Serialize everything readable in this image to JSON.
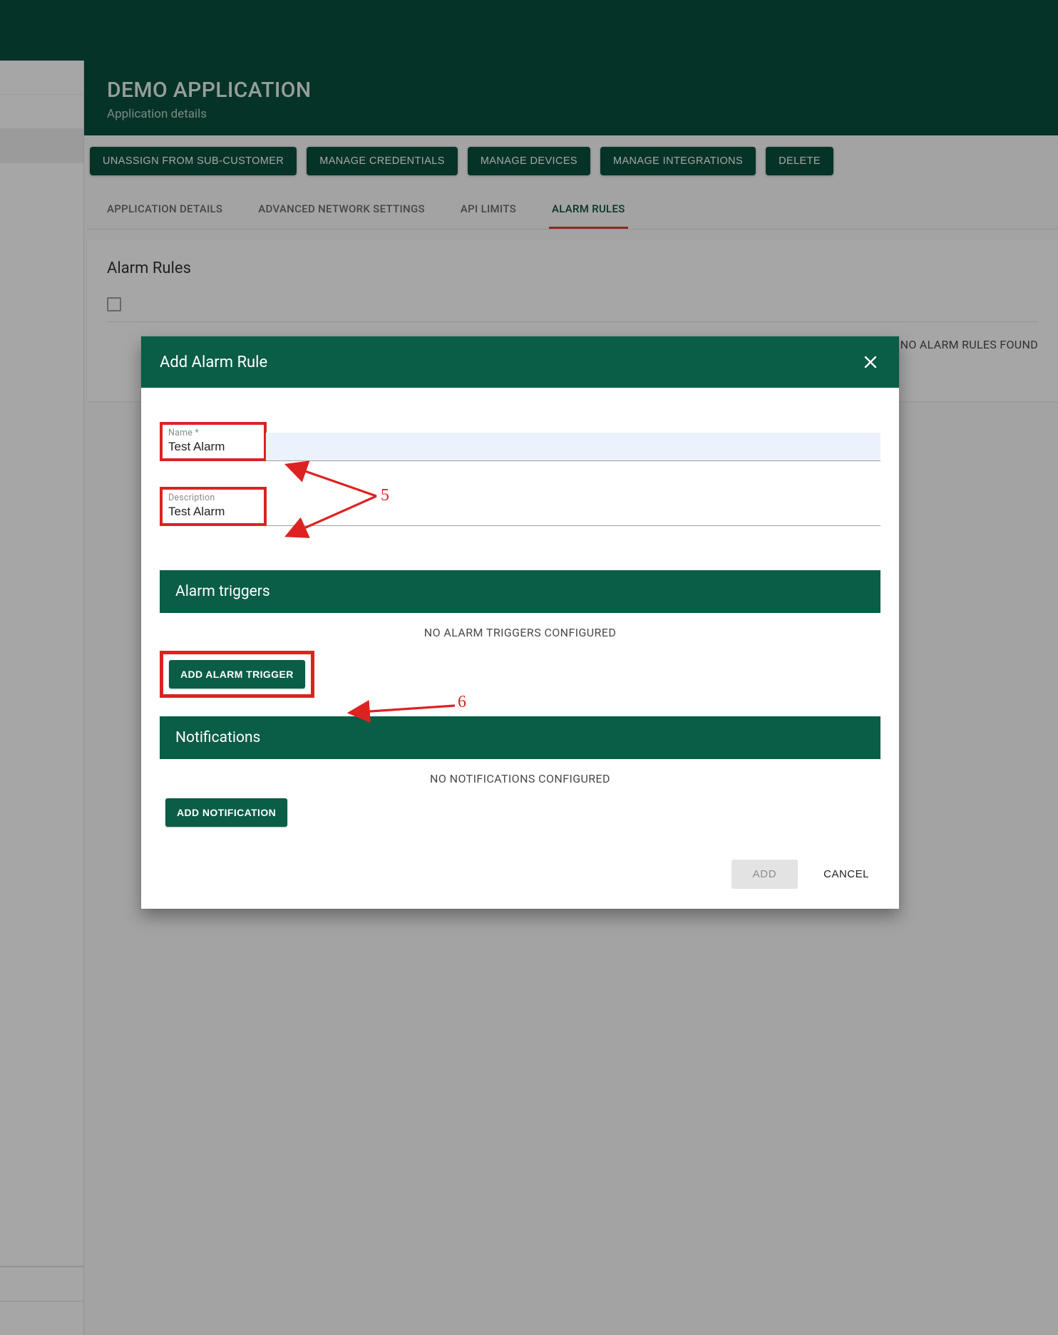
{
  "header": {
    "title": "DEMO APPLICATION",
    "subtitle": "Application details"
  },
  "action_buttons": {
    "unassign": "UNASSIGN FROM SUB-CUSTOMER",
    "manage_credentials": "MANAGE CREDENTIALS",
    "manage_devices": "MANAGE DEVICES",
    "manage_integrations": "MANAGE INTEGRATIONS",
    "delete": "DELETE"
  },
  "tabs": {
    "app_details": "APPLICATION DETAILS",
    "adv_network": "ADVANCED NETWORK SETTINGS",
    "api_limits": "API LIMITS",
    "alarm_rules": "ALARM RULES"
  },
  "panel": {
    "title": "Alarm Rules",
    "empty_message": "NO ALARM RULES FOUND"
  },
  "modal": {
    "title": "Add Alarm Rule",
    "name_label": "Name *",
    "name_value": "Test Alarm",
    "desc_label": "Description",
    "desc_value": "Test Alarm",
    "triggers_heading": "Alarm triggers",
    "triggers_empty": "NO ALARM TRIGGERS CONFIGURED",
    "add_trigger_btn": "ADD ALARM TRIGGER",
    "notifications_heading": "Notifications",
    "notifications_empty": "NO NOTIFICATIONS CONFIGURED",
    "add_notification_btn": "ADD NOTIFICATION",
    "add_btn": "ADD",
    "cancel_btn": "CANCEL"
  },
  "annotations": {
    "label_5": "5",
    "label_6": "6"
  },
  "colors": {
    "brand_dark": "#0a4f3c",
    "brand": "#0a5d47",
    "accent_red": "#d22",
    "tab_indicator": "#d84436"
  }
}
